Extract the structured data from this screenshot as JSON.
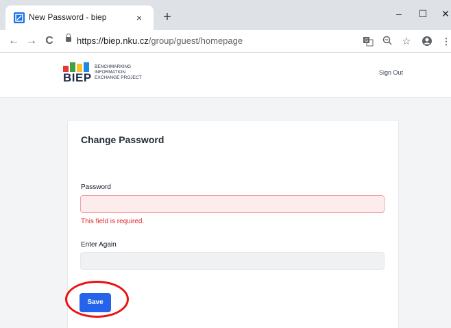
{
  "browser": {
    "tab_title": "New Password - biep",
    "tab_close": "×",
    "new_tab": "+",
    "url_host": "https://biep.nku.cz",
    "url_path": "/group/guest/homepage",
    "window_controls": {
      "minimize": "–",
      "maximize": "☐",
      "close": "✕"
    },
    "nav": {
      "back": "←",
      "forward": "→",
      "reload": "C"
    },
    "toolbar_icons": [
      "translate-icon",
      "zoom-icon",
      "star-icon",
      "account-icon",
      "menu-icon"
    ]
  },
  "site": {
    "logo": {
      "word": "BIEP",
      "tagline": "BENCHMARKING\nINFORMATION\nEXCHANGE PROJECT",
      "colors": [
        "#e53935",
        "#43a047",
        "#fbc02d",
        "#1e88e5"
      ]
    },
    "sign_out": "Sign Out"
  },
  "form": {
    "title": "Change Password",
    "password_label": "Password",
    "password_error": "This field is required.",
    "enter_again_label": "Enter Again",
    "save_label": "Save"
  },
  "colors": {
    "accent": "#2563eb",
    "error": "#dc2626",
    "highlight": "#ee1111"
  }
}
